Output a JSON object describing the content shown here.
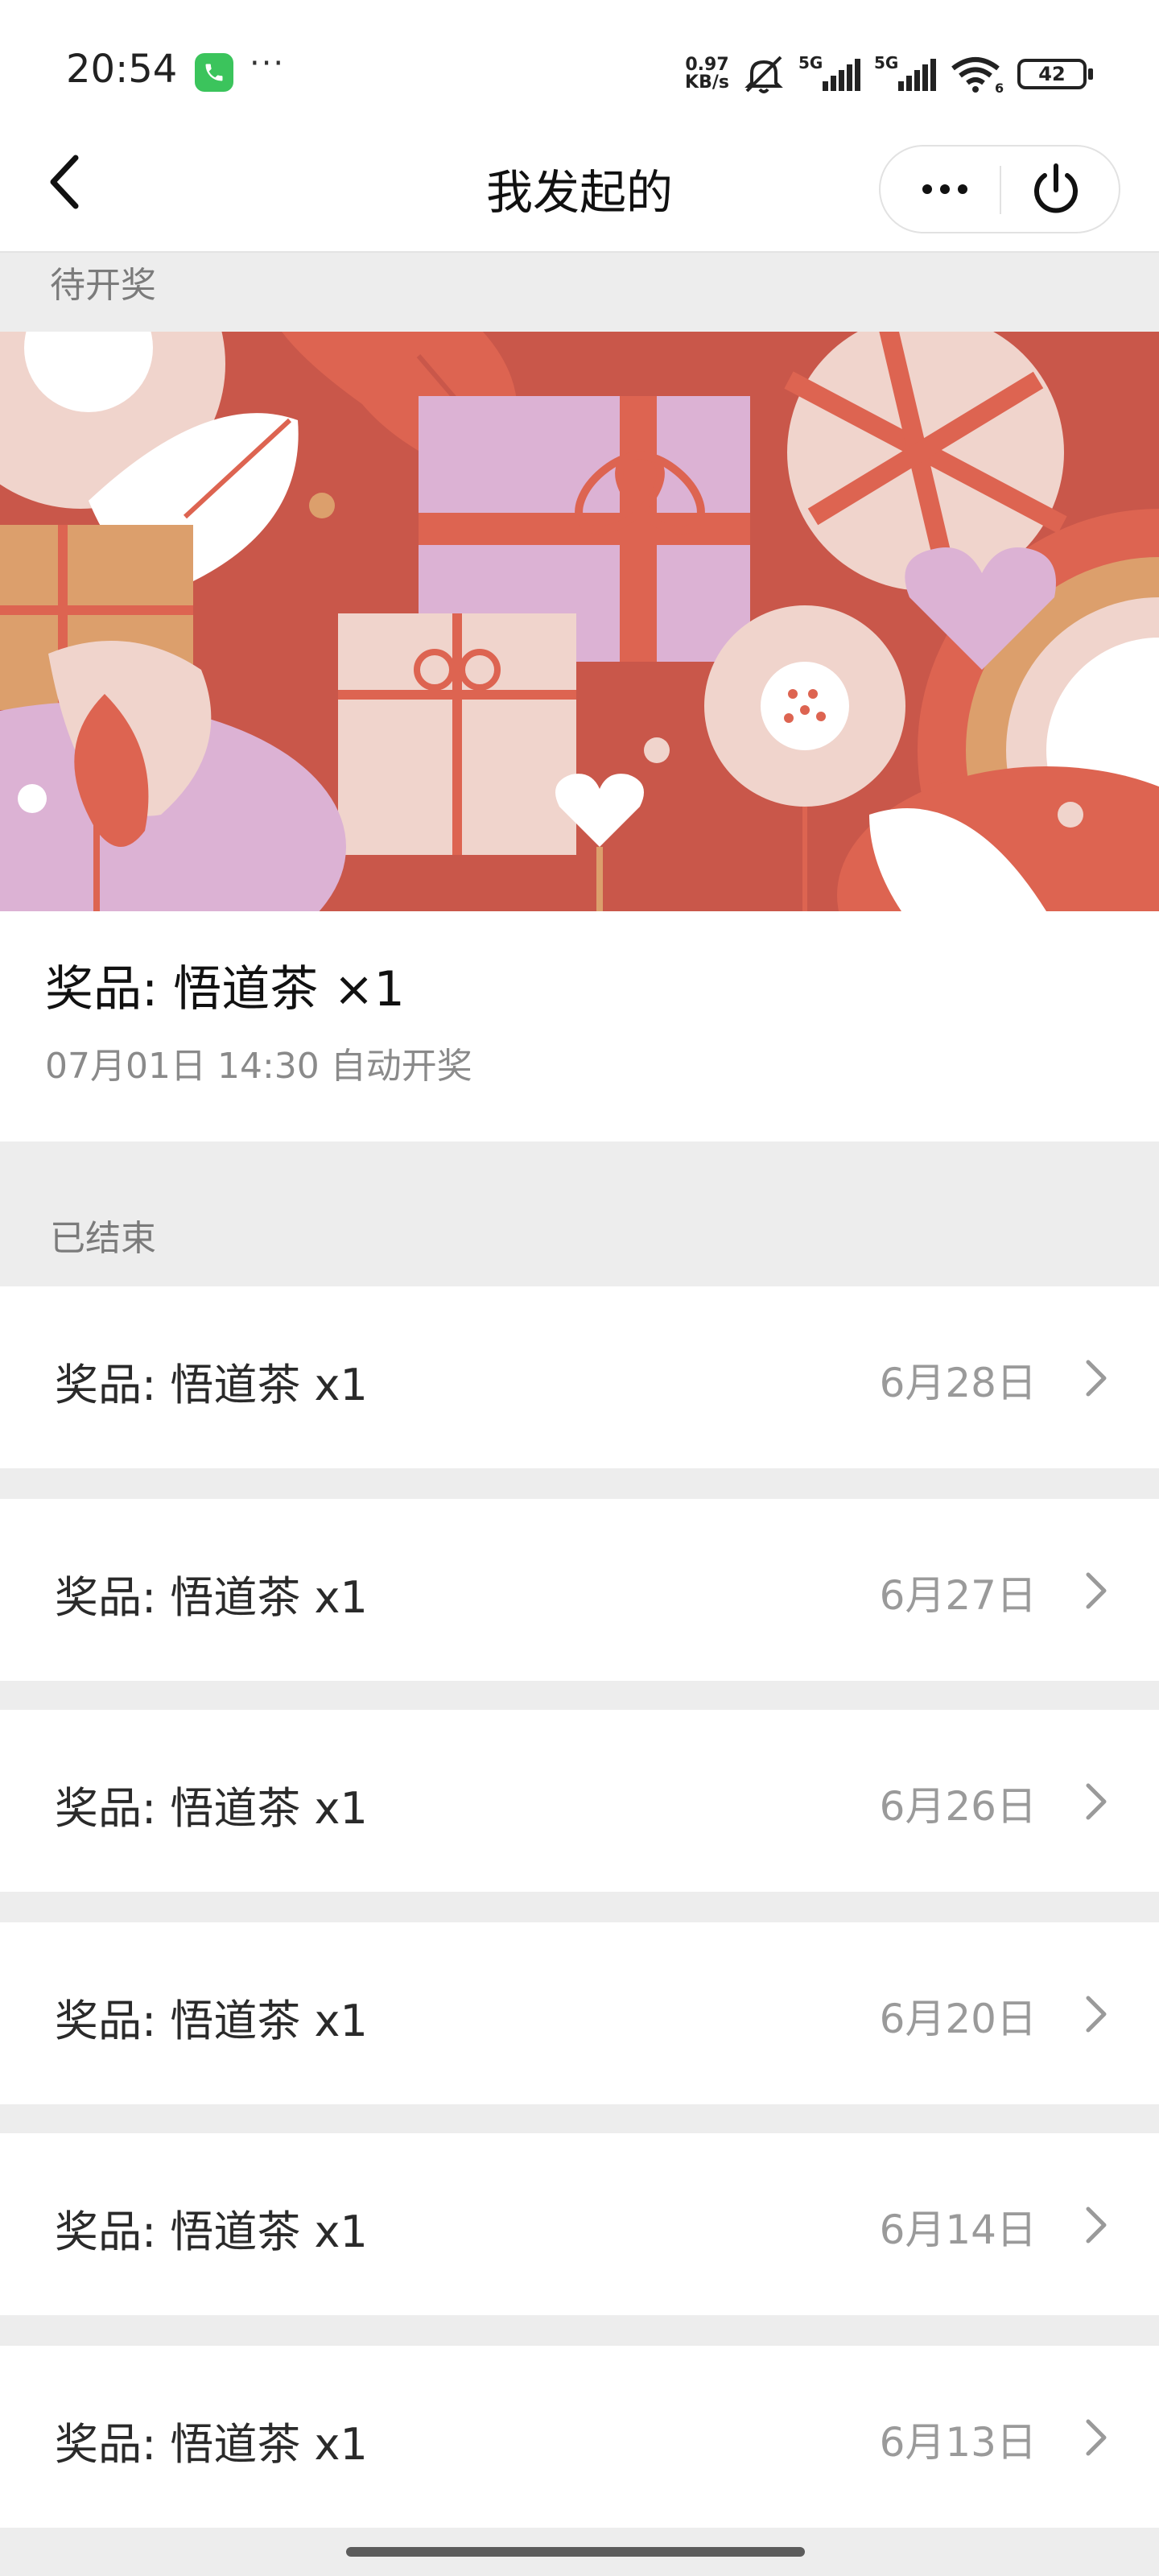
{
  "status_bar": {
    "time": "20:54",
    "more": "···",
    "net_speed_value": "0.97",
    "net_speed_unit": "KB/s",
    "signal1": "5G",
    "signal2": "5G",
    "wifi_badge": "6",
    "battery": "42"
  },
  "nav": {
    "title": "我发起的",
    "back_icon": "chevron-left-icon",
    "more_icon": "more-horizontal-icon",
    "power_icon": "power-icon"
  },
  "pending": {
    "section_label": "待开奖",
    "prize": "奖品: 悟道茶 ×1",
    "time": "07月01日 14:30 自动开奖"
  },
  "ended": {
    "section_label": "已结束",
    "items": [
      {
        "prize": "奖品: 悟道茶  x1",
        "date": "6月28日"
      },
      {
        "prize": "奖品: 悟道茶  x1",
        "date": "6月27日"
      },
      {
        "prize": "奖品: 悟道茶  x1",
        "date": "6月26日"
      },
      {
        "prize": "奖品: 悟道茶  x1",
        "date": "6月20日"
      },
      {
        "prize": "奖品: 悟道茶  x1",
        "date": "6月14日"
      },
      {
        "prize": "奖品: 悟道茶  x1",
        "date": "6月13日"
      }
    ]
  },
  "colors": {
    "banner_red": "#c9574a",
    "banner_pink": "#f0d4cc",
    "banner_lilac": "#dcb2d4",
    "banner_orange": "#dc9f6c",
    "banner_coral": "#dd6451"
  }
}
